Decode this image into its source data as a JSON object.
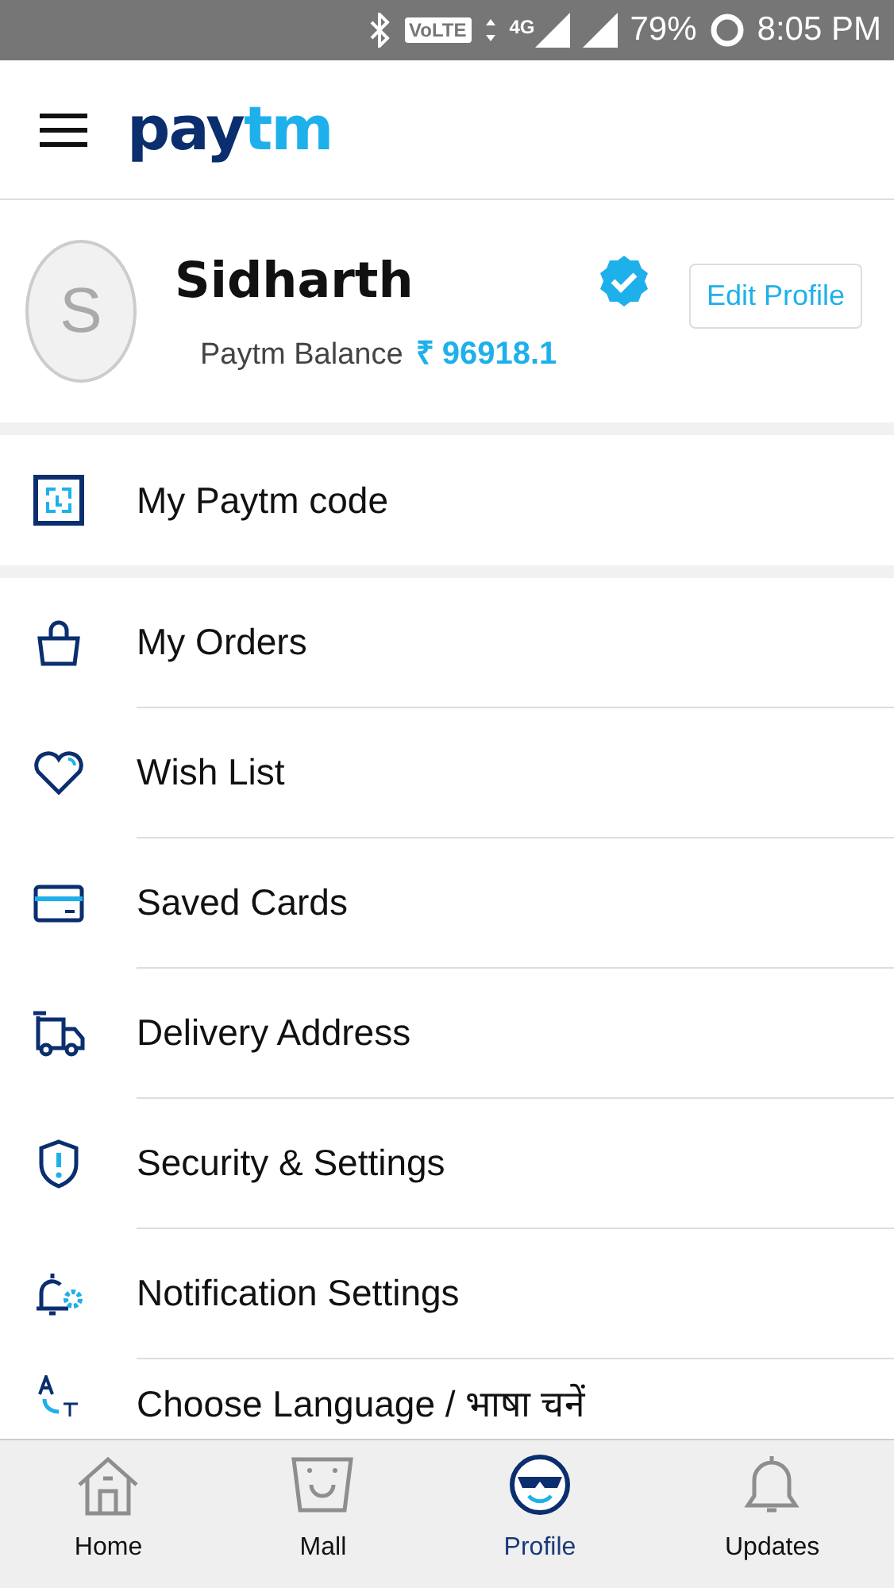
{
  "status_bar": {
    "volte": "VoLTE",
    "network": "4G",
    "battery": "79%",
    "time": "8:05 PM"
  },
  "header": {
    "logo_left": "pay",
    "logo_right": "tm"
  },
  "profile": {
    "initial": "S",
    "name": "Sidharth",
    "verified": true,
    "balance_label": "Paytm Balance",
    "balance": "₹ 96918.1",
    "edit_button": "Edit Profile"
  },
  "code_item": {
    "label": "My Paytm code"
  },
  "menu": [
    {
      "label": "My Orders"
    },
    {
      "label": "Wish List"
    },
    {
      "label": "Saved Cards"
    },
    {
      "label": "Delivery Address"
    },
    {
      "label": "Security & Settings"
    },
    {
      "label": "Notification Settings"
    },
    {
      "label": "Choose Language / भाषा चनें"
    }
  ],
  "bottom_nav": [
    {
      "label": "Home",
      "selected": false
    },
    {
      "label": "Mall",
      "selected": false
    },
    {
      "label": "Profile",
      "selected": true
    },
    {
      "label": "Updates",
      "selected": false
    }
  ]
}
